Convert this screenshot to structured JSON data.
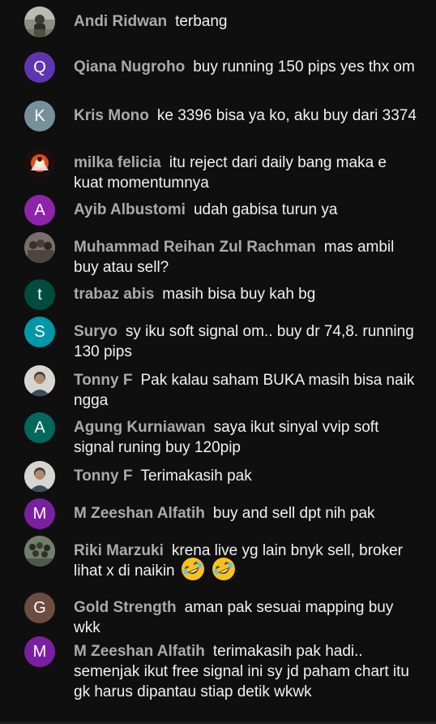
{
  "messages": [
    {
      "author": "Andi Ridwan",
      "text": "terbang",
      "avatar_letter": "",
      "avatar_color": "#5a5f55",
      "avatar_kind": "photo-outdoor"
    },
    {
      "author": "Qiana Nugroho",
      "text": "buy running 150 pips yes thx om",
      "avatar_letter": "Q",
      "avatar_color": "#5e35b1",
      "avatar_kind": "letter"
    },
    {
      "author": "Kris Mono",
      "text": "ke 3396 bisa ya ko, aku buy dari 3374",
      "avatar_letter": "K",
      "avatar_color": "#78909c",
      "avatar_kind": "letter"
    },
    {
      "author": "milka felicia",
      "text": "itu reject dari daily bang maka e kuat momentumnya",
      "avatar_letter": "",
      "avatar_color": "#2b1a14",
      "avatar_kind": "photo-fire"
    },
    {
      "author": "Ayib Albustomi",
      "text": "udah gabisa turun ya",
      "avatar_letter": "A",
      "avatar_color": "#8e24aa",
      "avatar_kind": "letter"
    },
    {
      "author": "Muhammad Reihan Zul Rachman",
      "text": "mas ambil buy atau sell?",
      "avatar_letter": "",
      "avatar_color": "#6b5e57",
      "avatar_kind": "photo-group"
    },
    {
      "author": "trabaz abis",
      "text": "masih bisa buy kah bg",
      "avatar_letter": "t",
      "avatar_color": "#004d40",
      "avatar_kind": "letter"
    },
    {
      "author": "Suryo",
      "text": "sy iku soft signal om.. buy dr 74,8. running 130 pips",
      "avatar_letter": "S",
      "avatar_color": "#0097a7",
      "avatar_kind": "letter"
    },
    {
      "author": "Tonny F",
      "text": "Pak kalau saham BUKA masih bisa naik ngga",
      "avatar_letter": "",
      "avatar_color": "#c9c4bd",
      "avatar_kind": "photo-person"
    },
    {
      "author": "Agung Kurniawan",
      "text": "saya ikut sinyal vvip soft signal runing buy 120pip",
      "avatar_letter": "A",
      "avatar_color": "#00695c",
      "avatar_kind": "letter"
    },
    {
      "author": "Tonny F",
      "text": "Terimakasih pak",
      "avatar_letter": "",
      "avatar_color": "#c9c4bd",
      "avatar_kind": "photo-person"
    },
    {
      "author": "M Zeeshan Alfatih",
      "text": "buy and sell dpt nih pak",
      "avatar_letter": "M",
      "avatar_color": "#7b1fa2",
      "avatar_kind": "letter"
    },
    {
      "author": "Riki Marzuki",
      "text": "krena live yg lain bnyk sell, broker lihat x di naikin",
      "avatar_letter": "",
      "avatar_color": "#5b6b5a",
      "avatar_kind": "photo-crowd",
      "emoji": [
        "rolling-on-floor-laughing-emoji",
        "rolling-on-floor-laughing-emoji"
      ]
    },
    {
      "author": "Gold Strength",
      "text": "aman pak sesuai mapping buy wkk",
      "avatar_letter": "G",
      "avatar_color": "#6d4c41",
      "avatar_kind": "letter"
    },
    {
      "author": "M Zeeshan Alfatih",
      "text": "terimakasih pak hadi.. semenjak ikut free signal ini sy jd paham chart itu gk harus dipantau stiap detik wkwk",
      "avatar_letter": "M",
      "avatar_color": "#7b1fa2",
      "avatar_kind": "letter"
    }
  ]
}
